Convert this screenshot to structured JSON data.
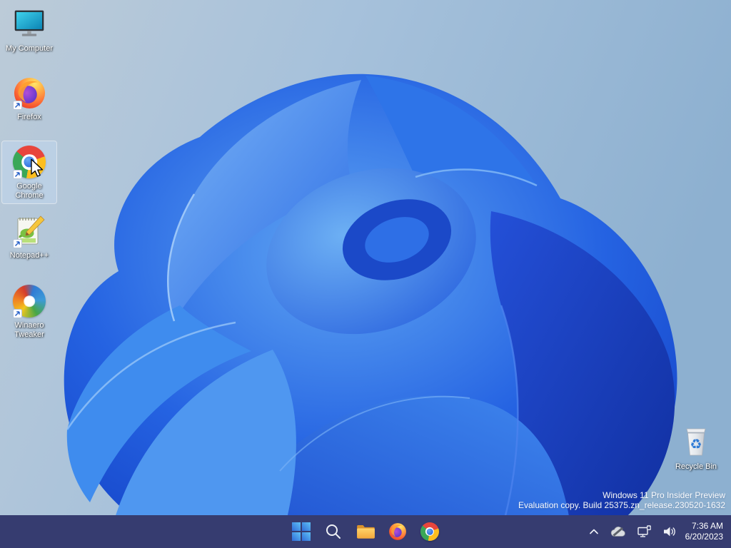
{
  "desktop": {
    "icons": [
      {
        "id": "my-computer",
        "label": "My Computer",
        "selected": false,
        "shortcut": false
      },
      {
        "id": "firefox",
        "label": "Firefox",
        "selected": false,
        "shortcut": true
      },
      {
        "id": "google-chrome",
        "label": "Google Chrome",
        "selected": true,
        "shortcut": true
      },
      {
        "id": "notepad-plus-plus",
        "label": "Notepad++",
        "selected": false,
        "shortcut": true
      },
      {
        "id": "winaero-tweaker",
        "label": "Winaero Tweaker",
        "selected": false,
        "shortcut": true
      },
      {
        "id": "recycle-bin",
        "label": "Recycle Bin",
        "selected": false,
        "shortcut": false
      }
    ],
    "watermark": {
      "line1": "Windows 11 Pro Insider Preview",
      "line2": "Evaluation copy. Build 25375.zn_release.230520-1632"
    }
  },
  "taskbar": {
    "buttons": [
      {
        "id": "start"
      },
      {
        "id": "search"
      },
      {
        "id": "file-explorer"
      },
      {
        "id": "firefox"
      },
      {
        "id": "chrome"
      }
    ],
    "tray": {
      "icons": [
        {
          "id": "chevron-up"
        },
        {
          "id": "onedrive-paused"
        },
        {
          "id": "network"
        },
        {
          "id": "volume"
        }
      ],
      "clock": {
        "time": "7:36 AM",
        "date": "6/20/2023"
      }
    }
  },
  "colors": {
    "taskbar_bg": "#363c70",
    "desktop_sky_left": "#a8c2db",
    "desktop_sky_right": "#8db0d0",
    "bloom_primary": "#2563e2",
    "bloom_dark": "#102e9e",
    "bloom_light": "#7ab4f6",
    "selection_highlight": "#c3daf2"
  }
}
